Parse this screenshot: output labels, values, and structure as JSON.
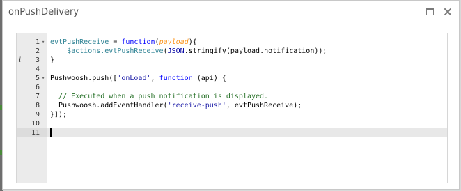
{
  "dialog": {
    "title": "onPushDelivery"
  },
  "editor": {
    "lines": [
      {
        "num": "1",
        "fold": true,
        "tokens": [
          {
            "t": "evtPushReceive",
            "c": "t-var"
          },
          {
            "t": " = ",
            "c": "t-plain"
          },
          {
            "t": "function",
            "c": "t-kw"
          },
          {
            "t": "(",
            "c": "t-plain"
          },
          {
            "t": "payload",
            "c": "t-param"
          },
          {
            "t": "){",
            "c": "t-plain"
          }
        ]
      },
      {
        "num": "2",
        "tokens": [
          {
            "t": "    ",
            "c": "t-plain"
          },
          {
            "t": "$actions.evtPushReceive",
            "c": "t-var"
          },
          {
            "t": "(",
            "c": "t-plain"
          },
          {
            "t": "JSON",
            "c": "t-type"
          },
          {
            "t": ".stringify(payload.notification));",
            "c": "t-plain"
          }
        ]
      },
      {
        "num": "3",
        "info": true,
        "tokens": [
          {
            "t": "}",
            "c": "t-plain"
          }
        ]
      },
      {
        "num": "4",
        "tokens": []
      },
      {
        "num": "5",
        "fold": true,
        "tokens": [
          {
            "t": "Pushwoosh.push([",
            "c": "t-plain"
          },
          {
            "t": "'onLoad'",
            "c": "t-str"
          },
          {
            "t": ", ",
            "c": "t-plain"
          },
          {
            "t": "function",
            "c": "t-kw"
          },
          {
            "t": " (api) {",
            "c": "t-plain"
          }
        ]
      },
      {
        "num": "6",
        "tokens": []
      },
      {
        "num": "7",
        "tokens": [
          {
            "t": "  ",
            "c": "t-plain"
          },
          {
            "t": "// Executed when a push notification is displayed.",
            "c": "t-cmt"
          }
        ]
      },
      {
        "num": "8",
        "tokens": [
          {
            "t": "  Pushwoosh.addEventHandler(",
            "c": "t-plain"
          },
          {
            "t": "'receive-push'",
            "c": "t-str"
          },
          {
            "t": ", evtPushReceive);",
            "c": "t-plain"
          }
        ]
      },
      {
        "num": "9",
        "tokens": [
          {
            "t": "}]);",
            "c": "t-plain"
          }
        ]
      },
      {
        "num": "10",
        "tokens": []
      },
      {
        "num": "11",
        "active": true,
        "tokens": []
      }
    ]
  },
  "icons": {
    "maximize": "maximize-icon",
    "close": "close-icon",
    "info": "info-icon",
    "fold": "fold-arrow-icon"
  },
  "colors": {
    "keyword": "#0000ff",
    "variable": "#318495",
    "parameter": "#fd971f",
    "string": "#1a1aa6",
    "comment": "#236e24",
    "gutter": "#ebebeb",
    "active_line": "#e8e8e8"
  }
}
